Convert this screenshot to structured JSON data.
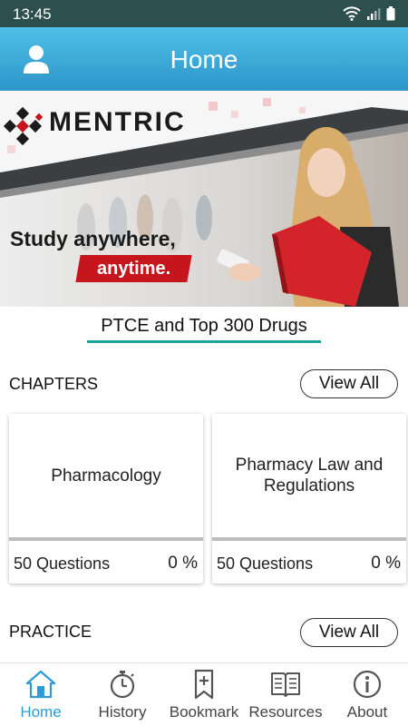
{
  "status_bar": {
    "time": "13:45"
  },
  "header": {
    "title": "Home"
  },
  "banner": {
    "brand": "MENTRIC",
    "tagline_1": "Study anywhere,",
    "tagline_2": "anytime."
  },
  "exam": {
    "title": "PTCE and Top 300 Drugs"
  },
  "chapters": {
    "heading": "CHAPTERS",
    "view_all_label": "View All",
    "cards": [
      {
        "name": "Pharmacology",
        "questions": "50 Questions",
        "percent": "0 %",
        "progress": 0
      },
      {
        "name": "Pharmacy Law and Regulations",
        "questions": "50 Questions",
        "percent": "0 %",
        "progress": 0
      }
    ]
  },
  "practice": {
    "heading": "PRACTICE",
    "view_all_label": "View All"
  },
  "bottom_nav": [
    {
      "label": "Home",
      "icon": "home-icon",
      "active": true
    },
    {
      "label": "History",
      "icon": "stopwatch-icon",
      "active": false
    },
    {
      "label": "Bookmark",
      "icon": "bookmark-icon",
      "active": false
    },
    {
      "label": "Resources",
      "icon": "book-icon",
      "active": false
    },
    {
      "label": "About",
      "icon": "info-icon",
      "active": false
    }
  ],
  "colors": {
    "header_top": "#4fc0e8",
    "header_bottom": "#2d95c9",
    "accent": "#19a69a",
    "brand_red": "#c4161c",
    "nav_active": "#2f9ad6"
  }
}
